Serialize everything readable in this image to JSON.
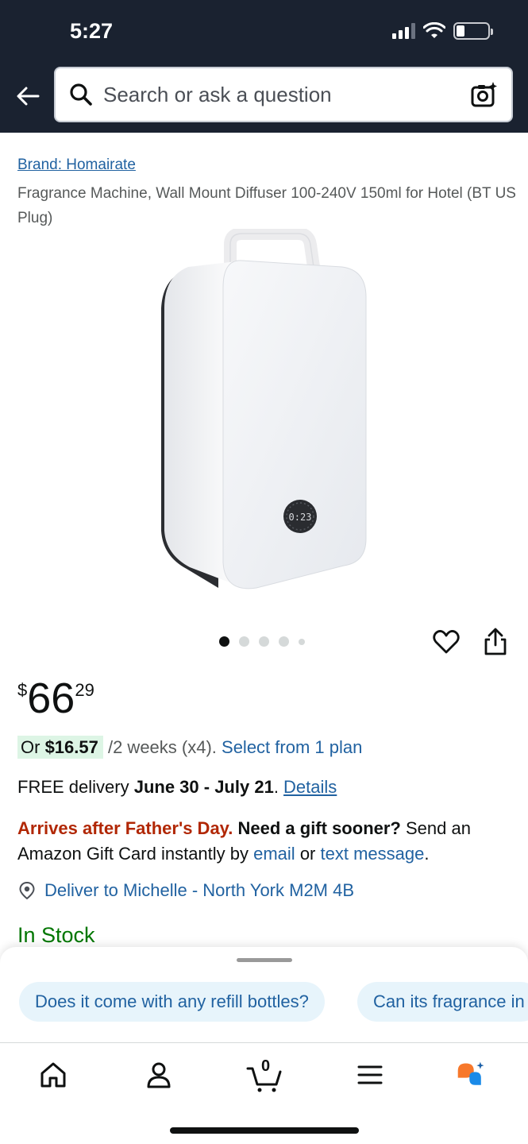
{
  "status_bar": {
    "time": "5:27"
  },
  "search": {
    "placeholder": "Search or ask a question"
  },
  "product": {
    "brand": "Brand: Homairate",
    "title": "Fragrance Machine, Wall Mount Diffuser 100-240V 150ml for Hotel (BT US Plug)",
    "display_reading": "0:23",
    "image_count": 5,
    "image_index": 1
  },
  "price": {
    "currency": "$",
    "whole": "66",
    "fraction": "29"
  },
  "plan": {
    "prefix": "Or ",
    "amount": "$16.57",
    "per": " /2 weeks (x4). ",
    "link": "Select from 1 plan"
  },
  "delivery": {
    "prefix": "FREE delivery ",
    "dates": "June 30 - July 21",
    "dot": ". ",
    "details_link": "Details"
  },
  "gift": {
    "warning": "Arrives after Father's Day.",
    "question": " Need a gift sooner?",
    "text1": " Send an Amazon Gift Card instantly by ",
    "email_link": "email",
    "or": " or ",
    "text_link": "text message",
    "end": "."
  },
  "deliver_to": {
    "label": "Deliver to Michelle - North York M2M 4B"
  },
  "stock": {
    "label": "In Stock"
  },
  "suggestions": [
    "Does it come with any refill bottles?",
    "Can its fragrance in"
  ],
  "icons": {
    "back": "back-arrow-icon",
    "search": "search-icon",
    "camera": "camera-search-icon",
    "heart": "heart-icon",
    "share": "share-icon",
    "location": "location-pin-icon",
    "home": "home-icon",
    "account": "account-icon",
    "cart": "cart-icon",
    "menu": "menu-icon",
    "rufus": "rufus-assistant-icon"
  },
  "cart": {
    "count": "0"
  },
  "colors": {
    "header_bg": "#1a2230",
    "link": "#2162a1",
    "in_stock": "#007600",
    "warning": "#b12704",
    "plan_highlight": "#ddf5e5",
    "chip_bg": "#e7f4fb",
    "rufus_orange": "#f7782b",
    "rufus_blue": "#1a8ae8"
  }
}
